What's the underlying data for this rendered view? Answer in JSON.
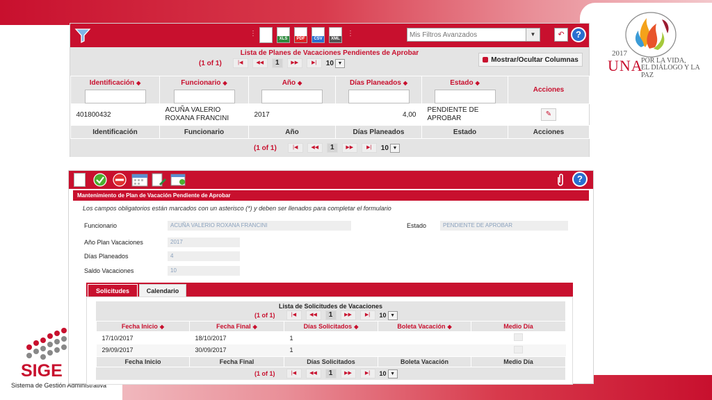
{
  "branding": {
    "una_year": "2017",
    "una_name": "UNA",
    "una_slogan_line1": "POR LA VIDA,",
    "una_slogan_line2": "EL DIÁLOGO Y LA PAZ",
    "sige_name": "SIGE",
    "sige_subtitle": "Sistema de Gestión Administrativa"
  },
  "colors": {
    "primary": "#c8102e",
    "header_bg": "#e4e4e4",
    "help": "#2a6fd0"
  },
  "list_panel": {
    "toolbar": {
      "filter_icon": "funnel-icon",
      "export_buttons": [
        {
          "name": "export-blank",
          "tag": ""
        },
        {
          "name": "export-xls",
          "tag": "XLS"
        },
        {
          "name": "export-pdf",
          "tag": "PDF"
        },
        {
          "name": "export-csv",
          "tag": "CSV"
        },
        {
          "name": "export-xml",
          "tag": "XML"
        }
      ],
      "filters_placeholder": "Mis Filtros Avanzados",
      "undo_icon": "undo-icon",
      "help_label": "?"
    },
    "caption": "Lista de Planes de Vacaciones Pendientes de Aprobar",
    "pager": {
      "count": "(1 of 1)",
      "current": "1",
      "rows_per_page": "10"
    },
    "show_columns_label": "Mostrar/Ocultar Columnas",
    "columns": [
      "Identificación",
      "Funcionario",
      "Año",
      "Días Planeados",
      "Estado",
      "Acciones"
    ],
    "rows": [
      {
        "identificacion": "401800432",
        "funcionario": "ACUÑA VALERIO ROXANA FRANCINI",
        "anio": "2017",
        "dias": "4,00",
        "estado": "PENDIENTE DE APROBAR"
      }
    ]
  },
  "form_panel": {
    "toolbar": {
      "buttons": [
        "new-doc-icon",
        "accept-icon",
        "cancel-icon",
        "calendar-icon",
        "doc-edit-icon",
        "user-calendar-icon"
      ],
      "attach_icon": "paperclip-icon",
      "help_label": "?"
    },
    "title": "Mantenimiento de Plan de Vacación Pendiente de Aprobar",
    "note": "Los campos obligatorios están marcados con un asterisco (*) y deben ser llenados para completar el formulario",
    "fields": {
      "funcionario_label": "Funcionario",
      "funcionario_value": "ACUÑA VALERIO ROXANA FRANCINI",
      "estado_label": "Estado",
      "estado_value": "PENDIENTE DE APROBAR",
      "anio_label": "Año Plan Vacaciones",
      "anio_value": "2017",
      "dias_label": "Días Planeados",
      "dias_value": "4",
      "saldo_label": "Saldo Vacaciones",
      "saldo_value": "10"
    },
    "tabs": [
      "Solicitudes",
      "Calendario"
    ],
    "requests": {
      "caption": "Lista de Solicitudes de Vacaciones",
      "pager": {
        "count": "(1 of 1)",
        "current": "1",
        "rows_per_page": "10"
      },
      "columns": [
        "Fecha Inicio",
        "Fecha Final",
        "Días Solicitados",
        "Boleta Vacación",
        "Medio Día"
      ],
      "rows": [
        {
          "inicio": "17/10/2017",
          "final": "18/10/2017",
          "dias": "1",
          "boleta": ""
        },
        {
          "inicio": "29/09/2017",
          "final": "30/09/2017",
          "dias": "1",
          "boleta": ""
        }
      ]
    }
  }
}
